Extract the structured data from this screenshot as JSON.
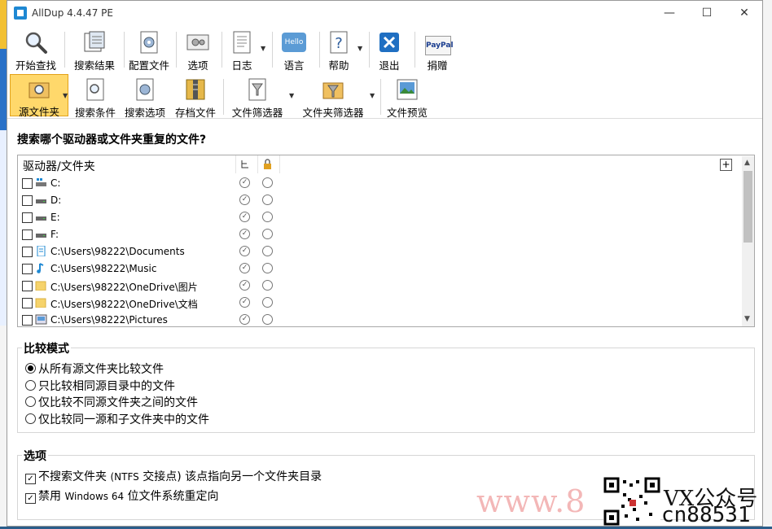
{
  "window": {
    "title": "AllDup 4.4.47 PE",
    "min": "—",
    "max": "☐",
    "close": "✕"
  },
  "toolbar1": [
    {
      "label": "开始查找",
      "icon": "magnifier-icon"
    },
    {
      "label": "搜索结果",
      "icon": "results-icon"
    },
    {
      "label": "配置文件",
      "icon": "profile-icon"
    },
    {
      "label": "选项",
      "icon": "options-icon"
    },
    {
      "label": "日志",
      "icon": "log-icon"
    },
    {
      "label": "语言",
      "icon": "language-icon",
      "badge": "Hello"
    },
    {
      "label": "帮助",
      "icon": "help-icon"
    },
    {
      "label": "退出",
      "icon": "exit-icon"
    },
    {
      "label": "捐赠",
      "icon": "paypal-icon",
      "badge": "PayPal"
    }
  ],
  "toolbar2": [
    {
      "label": "源文件夹",
      "icon": "source-folder-icon"
    },
    {
      "label": "搜索条件",
      "icon": "search-criteria-icon"
    },
    {
      "label": "搜索选项",
      "icon": "search-options-icon"
    },
    {
      "label": "存档文件",
      "icon": "archive-icon"
    },
    {
      "label": "文件筛选器",
      "icon": "file-filter-icon"
    },
    {
      "label": "文件夹筛选器",
      "icon": "folder-filter-icon"
    },
    {
      "label": "文件预览",
      "icon": "file-preview-icon"
    }
  ],
  "heading": "搜索哪个驱动器或文件夹重复的文件?",
  "folder_list": {
    "column_header": "驱动器/文件夹",
    "add_button": "+",
    "rows": [
      {
        "path": "C:",
        "icon": "drive-system-icon"
      },
      {
        "path": "D:",
        "icon": "drive-icon"
      },
      {
        "path": "E:",
        "icon": "drive-icon"
      },
      {
        "path": "F:",
        "icon": "drive-icon"
      },
      {
        "path": "C:\\Users\\98222\\Documents",
        "icon": "document-icon"
      },
      {
        "path": "C:\\Users\\98222\\Music",
        "icon": "music-note-icon"
      },
      {
        "path": "C:\\Users\\98222\\OneDrive\\图片",
        "icon": "folder-icon"
      },
      {
        "path": "C:\\Users\\98222\\OneDrive\\文档",
        "icon": "folder-icon"
      },
      {
        "path": "C:\\Users\\98222\\Pictures",
        "icon": "picture-icon"
      }
    ]
  },
  "compare_mode": {
    "title": "比较模式",
    "options": [
      {
        "label": "从所有源文件夹比较文件",
        "selected": true
      },
      {
        "label": "只比较相同源目录中的文件",
        "selected": false
      },
      {
        "label": "仅比较不同源文件夹之间的文件",
        "selected": false
      },
      {
        "label": "仅比较同一源和子文件夹中的文件",
        "selected": false
      }
    ]
  },
  "options": {
    "title": "选项",
    "items": [
      {
        "pre": "不搜索文件夹 ",
        "small": "(NTFS",
        "post": " 交接点) 该点指向另一个文件夹目录",
        "checked": true
      },
      {
        "pre": "禁用 ",
        "small": "Windows 64",
        "post": " 位文件系统重定向",
        "checked": true
      }
    ]
  },
  "watermark": {
    "url": "www.8",
    "vx": "VX公众号",
    "id": "cn88531"
  },
  "colors": {
    "active_tool": "#ffd86b",
    "accent": "#1e88d3"
  }
}
